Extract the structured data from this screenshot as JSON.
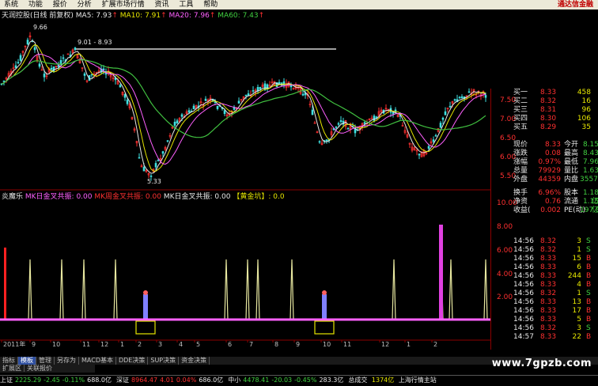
{
  "menu": {
    "items": [
      "系统",
      "功能",
      "报价",
      "分析",
      "扩展市场行情",
      "资讯",
      "工具",
      "帮助"
    ],
    "logo": "通达信金融"
  },
  "ma_header": {
    "title": "天润控股(日线 前复权)",
    "ma5_label": "MA5: ",
    "ma5": "7.93",
    "ma10_label": "MA10: ",
    "ma10": "7.91",
    "ma20_label": "MA20: ",
    "ma20": "7.96",
    "ma60_label": "MA60: ",
    "ma60": "7.43"
  },
  "price_annotations": {
    "high": "9.66",
    "range": "9.01 - 8.93",
    "low": "5.33"
  },
  "price_axis": [
    "7.50",
    "7.00",
    "6.50",
    "6.00",
    "5.50"
  ],
  "indicator_header": {
    "name": "炎魔乐",
    "item1": "MK日金叉共振: 0.00",
    "item2": "MK周金叉共振: 0.00",
    "item3": "MK日金叉共振: 0.00",
    "item4": "【黄金坑】: 0.0"
  },
  "indicator_axis": [
    "10.00",
    "8.00",
    "6.00",
    "4.00",
    "2.00"
  ],
  "date_axis": [
    "2011年",
    "9",
    "10",
    "11",
    "12",
    "1",
    "2",
    "3",
    "4",
    "5",
    "6",
    "7",
    "8",
    "9",
    "10",
    "11",
    "12",
    "1",
    "2"
  ],
  "quote_bids": [
    {
      "label": "买一",
      "price": "8.33",
      "vol": "458"
    },
    {
      "label": "买二",
      "price": "8.32",
      "vol": "16"
    },
    {
      "label": "买三",
      "price": "8.31",
      "vol": "96"
    },
    {
      "label": "买四",
      "price": "8.30",
      "vol": "106"
    },
    {
      "label": "买五",
      "price": "8.29",
      "vol": "35"
    }
  ],
  "quote_stats": [
    {
      "l1": "现价",
      "v1": "8.33",
      "l2": "今开",
      "v2": "8.15"
    },
    {
      "l1": "涨跌",
      "v1": "0.08",
      "l2": "最高",
      "v2": "8.43"
    },
    {
      "l1": "涨幅",
      "v1": "0.97%",
      "l2": "最低",
      "v2": "7.96"
    },
    {
      "l1": "总量",
      "v1": "79929",
      "l2": "量比",
      "v2": "1.63"
    },
    {
      "l1": "外盘",
      "v1": "44359",
      "l2": "内盘",
      "v2": "35570"
    }
  ],
  "quote_stats2": [
    {
      "l1": "换手",
      "v1": "6.96%",
      "l2": "股本",
      "v2": "1.18亿"
    },
    {
      "l1": "净资",
      "v1": "0.76",
      "l2": "流通",
      "v2": "1.15亿"
    },
    {
      "l1": "收益(",
      "v1": "0.002",
      "l2": "PE(动)",
      "v2": "197.8"
    }
  ],
  "ticks": [
    {
      "t": "14:56",
      "p": "8.32",
      "v": "3",
      "s": "S"
    },
    {
      "t": "14:56",
      "p": "8.32",
      "v": "1",
      "s": "S"
    },
    {
      "t": "14:56",
      "p": "8.33",
      "v": "15",
      "s": "B"
    },
    {
      "t": "14:56",
      "p": "8.33",
      "v": "6",
      "s": "B"
    },
    {
      "t": "14:56",
      "p": "8.33",
      "v": "244",
      "s": "B"
    },
    {
      "t": "14:56",
      "p": "8.33",
      "v": "4",
      "s": "B"
    },
    {
      "t": "14:56",
      "p": "8.32",
      "v": "1",
      "s": "S"
    },
    {
      "t": "14:56",
      "p": "8.33",
      "v": "13",
      "s": "B"
    },
    {
      "t": "14:56",
      "p": "8.33",
      "v": "17",
      "s": "B"
    },
    {
      "t": "14:56",
      "p": "8.33",
      "v": "5",
      "s": "B"
    },
    {
      "t": "14:56",
      "p": "8.32",
      "v": "3",
      "s": "S"
    },
    {
      "t": "14:57",
      "p": "8.33",
      "v": "22",
      "s": "B"
    }
  ],
  "tabs": [
    "指标",
    "模板",
    "管理",
    "另存为",
    "MACD基本",
    "DDE决策",
    "SUP决策",
    "资金决策"
  ],
  "tabs_active_index": 1,
  "tabs2": [
    "扩展区",
    "关联报价"
  ],
  "status": [
    {
      "name": "上证",
      "val": "2225.29",
      "chg": "-2.45",
      "pct": "-0.11%",
      "amt": "688.0亿"
    },
    {
      "name": "深证",
      "val": "8964.47",
      "chg": "4.01",
      "pct": "0.04%",
      "amt": "686.0亿"
    },
    {
      "name": "中小",
      "val": "4478.41",
      "chg": "-20.03",
      "pct": "-0.45%",
      "amt": "283.3亿"
    }
  ],
  "status_extra": {
    "label": "总成交",
    "amount": "1374亿",
    "site": "上海行情主站"
  },
  "watermark": "www.7gpzb.com"
}
